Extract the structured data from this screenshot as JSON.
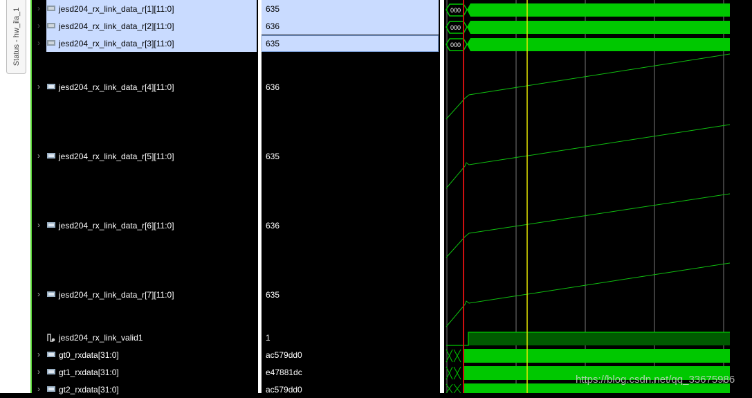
{
  "side_tab": {
    "label": "Status - hw_ila_1"
  },
  "signals": [
    {
      "name": "jesd204_rx_link_data_r[1][11:0]",
      "value": "635",
      "selected": true,
      "bus_text": "000"
    },
    {
      "name": "jesd204_rx_link_data_r[2][11:0]",
      "value": "636",
      "selected": true,
      "bus_text": "000"
    },
    {
      "name": "jesd204_rx_link_data_r[3][11:0]",
      "value": "635",
      "selected": true,
      "bus_text": "000"
    },
    {
      "name": "jesd204_rx_link_data_r[4][11:0]",
      "value": "636"
    },
    {
      "name": "jesd204_rx_link_data_r[5][11:0]",
      "value": "635"
    },
    {
      "name": "jesd204_rx_link_data_r[6][11:0]",
      "value": "636"
    },
    {
      "name": "jesd204_rx_link_data_r[7][11:0]",
      "value": "635"
    },
    {
      "name": "jesd204_rx_link_valid1",
      "value": "1"
    },
    {
      "name": "gt0_rxdata[31:0]",
      "value": "ac579dd0"
    },
    {
      "name": "gt1_rxdata[31:0]",
      "value": "e47881dc"
    },
    {
      "name": "gt2_rxdata[31:0]",
      "value": "ac579dd0"
    }
  ],
  "watermark": "https://blog.csdn.net/qq_33675986",
  "colors": {
    "waveform": "#00c800",
    "cursor_red": "#d01010",
    "cursor_yellow": "#e8e800",
    "selection": "#c9dbff"
  }
}
